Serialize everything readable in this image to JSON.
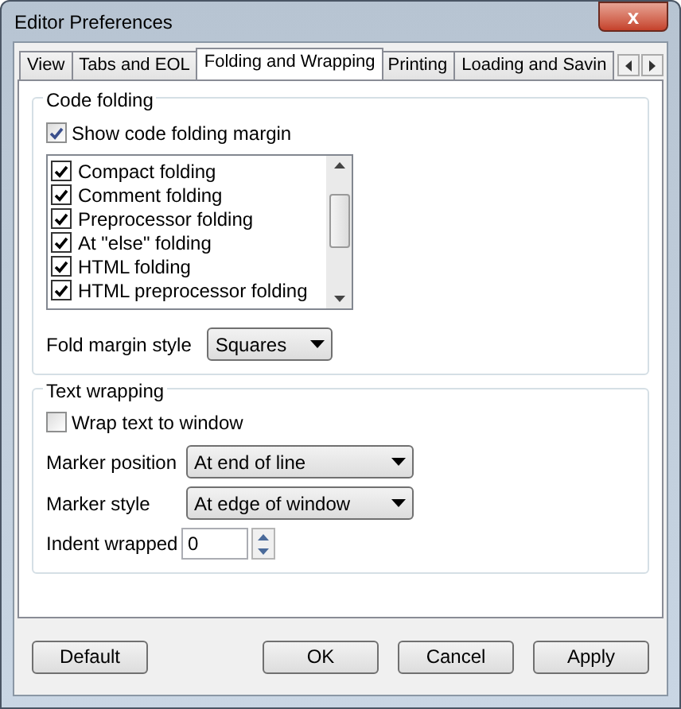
{
  "window": {
    "title": "Editor Preferences",
    "close_symbol": "x"
  },
  "tabs": [
    {
      "label": "View",
      "selected": false
    },
    {
      "label": "Tabs and EOL",
      "selected": false
    },
    {
      "label": "Folding and Wrapping",
      "selected": true
    },
    {
      "label": "Printing",
      "selected": false
    },
    {
      "label": "Loading and Savin",
      "selected": false
    }
  ],
  "code_folding": {
    "title": "Code folding",
    "show_margin": {
      "label": "Show code folding margin",
      "checked": true
    },
    "options": [
      {
        "label": "Compact folding",
        "checked": true
      },
      {
        "label": "Comment folding",
        "checked": true
      },
      {
        "label": "Preprocessor folding",
        "checked": true
      },
      {
        "label": "At \"else\" folding",
        "checked": true
      },
      {
        "label": "HTML folding",
        "checked": true
      },
      {
        "label": "HTML preprocessor folding",
        "checked": true
      }
    ],
    "fold_margin_style": {
      "label": "Fold margin style",
      "value": "Squares"
    }
  },
  "text_wrapping": {
    "title": "Text wrapping",
    "wrap": {
      "label": "Wrap text to window",
      "checked": false
    },
    "marker_position": {
      "label": "Marker position",
      "value": "At end of line"
    },
    "marker_style": {
      "label": "Marker style",
      "value": "At edge of window"
    },
    "indent_wrapped": {
      "label": "Indent wrapped",
      "value": "0"
    }
  },
  "buttons": [
    {
      "label": "Default"
    },
    {
      "label": "OK"
    },
    {
      "label": "Cancel"
    },
    {
      "label": "Apply"
    }
  ]
}
